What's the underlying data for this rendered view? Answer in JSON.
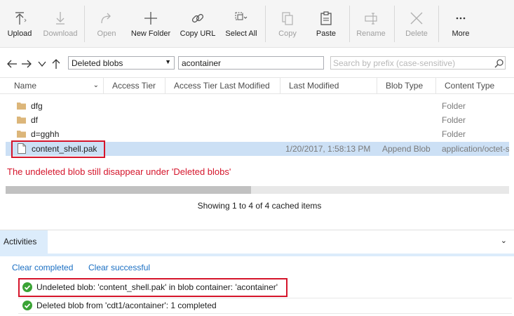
{
  "toolbar": {
    "buttons": [
      {
        "label": "Upload",
        "icon": "upload-icon",
        "enabled": true
      },
      {
        "label": "Download",
        "icon": "download-icon",
        "enabled": false
      },
      {
        "label": "Open",
        "icon": "open-icon",
        "enabled": false
      },
      {
        "label": "New Folder",
        "icon": "plus-icon",
        "enabled": true
      },
      {
        "label": "Copy URL",
        "icon": "link-icon",
        "enabled": true
      },
      {
        "label": "Select All",
        "icon": "select-all-icon",
        "enabled": true
      },
      {
        "label": "Copy",
        "icon": "copy-icon",
        "enabled": false
      },
      {
        "label": "Paste",
        "icon": "paste-icon",
        "enabled": true
      },
      {
        "label": "Rename",
        "icon": "rename-icon",
        "enabled": false
      },
      {
        "label": "Delete",
        "icon": "delete-icon",
        "enabled": false
      },
      {
        "label": "More",
        "icon": "more-icon",
        "enabled": true
      }
    ]
  },
  "address": {
    "view_selected": "Deleted blobs",
    "container": "acontainer",
    "search_placeholder": "Search by prefix (case-sensitive)"
  },
  "columns": [
    "Name",
    "Access Tier",
    "Access Tier Last Modified",
    "Last Modified",
    "Blob Type",
    "Content Type"
  ],
  "rows": [
    {
      "name": "dfg",
      "type": "folder",
      "last_modified": "",
      "blob_type": "",
      "content_type": "Folder"
    },
    {
      "name": "df",
      "type": "folder",
      "last_modified": "",
      "blob_type": "",
      "content_type": "Folder"
    },
    {
      "name": "d=gghh",
      "type": "folder",
      "last_modified": "",
      "blob_type": "",
      "content_type": "Folder"
    },
    {
      "name": "content_shell.pak",
      "type": "file",
      "last_modified": "1/20/2017, 1:58:13 PM",
      "blob_type": "Append Blob",
      "content_type": "application/octet-s"
    }
  ],
  "annotation": "The undeleted blob still disappear under 'Deleted blobs'",
  "status": "Showing 1 to 4 of 4 cached items",
  "activities": {
    "tab_label": "Activities",
    "clear_completed": "Clear completed",
    "clear_successful": "Clear successful",
    "items": [
      {
        "text": "Undeleted blob: 'content_shell.pak' in blob container: 'acontainer'",
        "status": "success"
      },
      {
        "text": "Deleted blob from 'cdt1/acontainer': 1 completed",
        "status": "success"
      }
    ]
  },
  "colors": {
    "accent": "#1a6fc3",
    "selection": "#cce0f5",
    "highlight_red": "#d5152b",
    "success_green": "#3aa335",
    "folder": "#dcb67a"
  }
}
